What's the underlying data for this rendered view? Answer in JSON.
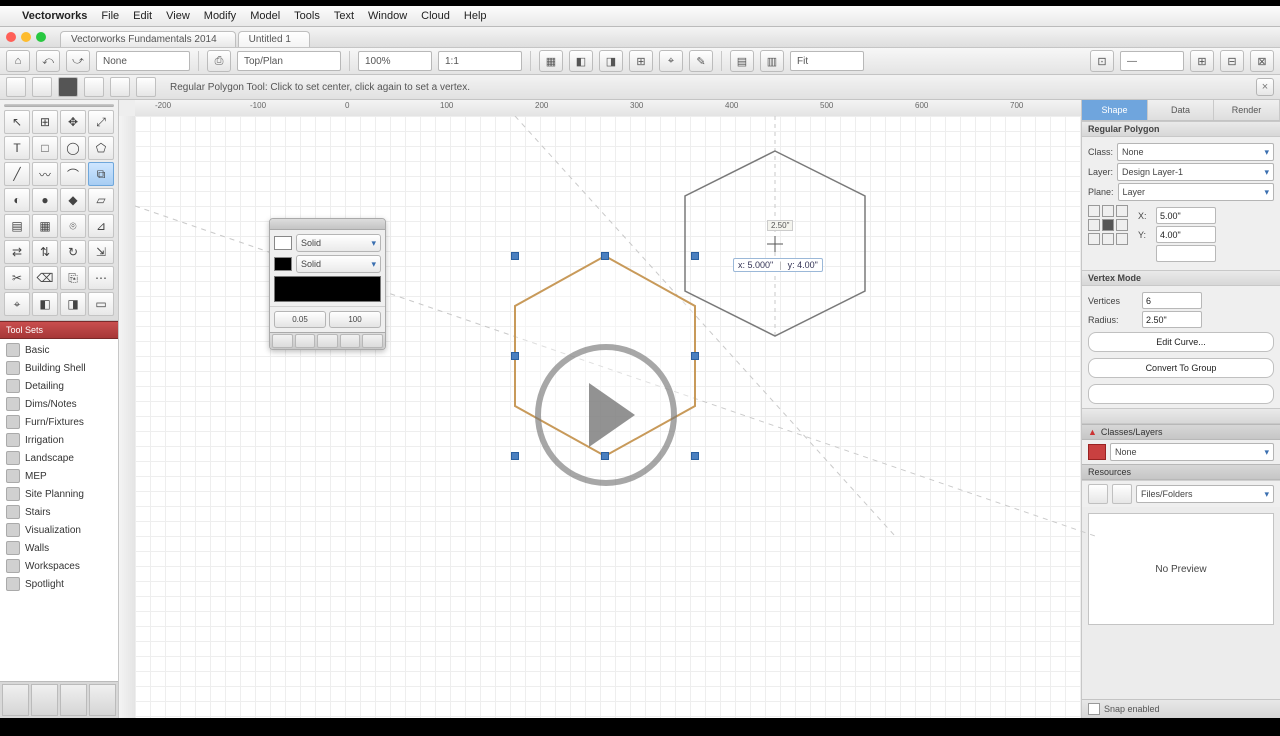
{
  "menubar": {
    "app": "Vectorworks",
    "items": [
      "File",
      "Edit",
      "View",
      "Modify",
      "Model",
      "Tools",
      "Text",
      "Window",
      "Cloud",
      "Help"
    ]
  },
  "window": {
    "tabs": [
      "Vectorworks Fundamentals 2014",
      "Untitled 1"
    ],
    "active_tab": 1
  },
  "toolbar1": {
    "layer_field": "None",
    "btns": [
      "⌂",
      "⤺",
      "⤻",
      "⎙"
    ],
    "view_field": "Top/Plan",
    "zoom_field": "100%",
    "scale_field": "1:1",
    "fit": "Fit"
  },
  "toolbar2": {
    "hint": "Regular Polygon Tool: Click to set center, click again to set a vertex."
  },
  "ruler": {
    "marks": [
      "-200",
      "-100",
      "0",
      "100",
      "200",
      "300",
      "400",
      "500",
      "600",
      "700"
    ]
  },
  "tools": {
    "rows": [
      [
        "↖",
        "⊞",
        "✥",
        "⤢"
      ],
      [
        "T",
        "□",
        "◯",
        "⬠"
      ],
      [
        "╱",
        "〰",
        "⌒",
        "⧉"
      ],
      [
        "◐",
        "●",
        "◆",
        "▱"
      ],
      [
        "▤",
        "▦",
        "⌾",
        "⊿"
      ],
      [
        "⇄",
        "⇅",
        "↻",
        "⇲"
      ],
      [
        "✂",
        "⌫",
        "⎘",
        "⋯"
      ],
      [
        "⌖",
        "◧",
        "◨",
        "▭"
      ]
    ],
    "selected": [
      2,
      3
    ]
  },
  "nav": {
    "header": "Tool Sets",
    "items": [
      "Basic",
      "Building Shell",
      "Detailing",
      "Dims/Notes",
      "Furn/Fixtures",
      "Irrigation",
      "Landscape",
      "MEP",
      "Site Planning",
      "Stairs",
      "Visualization",
      "Walls",
      "Workspaces",
      "Spotlight"
    ]
  },
  "attrs": {
    "fill_label": "Solid",
    "pen_label": "Solid",
    "line_label": "0.05",
    "opacity": "100"
  },
  "canvas": {
    "dim_label": "2.50\"",
    "coord_x": "x: 5.000\"",
    "coord_y": "y: 4.00\""
  },
  "obj": {
    "tabs": [
      "Shape",
      "Data",
      "Render"
    ],
    "header": "Regular Polygon",
    "class_label": "Class:",
    "class_value": "None",
    "layer_label": "Layer:",
    "layer_value": "Design Layer-1",
    "plane_label": "Plane:",
    "plane_value": "Layer",
    "fields": [
      {
        "k": "X:",
        "v": "5.00\""
      },
      {
        "k": "Y:",
        "v": "4.00\""
      },
      {
        "k": "",
        "v": ""
      }
    ],
    "more_header": "Vertex Mode",
    "vert": "Vertices",
    "vert_v": "6",
    "radius": "Radius:",
    "radius_v": "2.50\"",
    "edit_btn": "Edit Curve...",
    "convert_btn": "Convert To Group"
  },
  "classes": {
    "header": "Classes/Layers",
    "field": "None"
  },
  "resources": {
    "header": "Resources",
    "field": "Files/Folders",
    "preview": "No Preview"
  },
  "footer": {
    "snap": "Snap enabled"
  },
  "colors": {
    "traffic": [
      "#ff5f57",
      "#febc2e",
      "#28c840"
    ],
    "fill": "#ffffff",
    "pen": "#000000",
    "accent": "#3a6fb0",
    "hex_sel": "#c89a5a",
    "hex2": "#7a7a7a"
  }
}
